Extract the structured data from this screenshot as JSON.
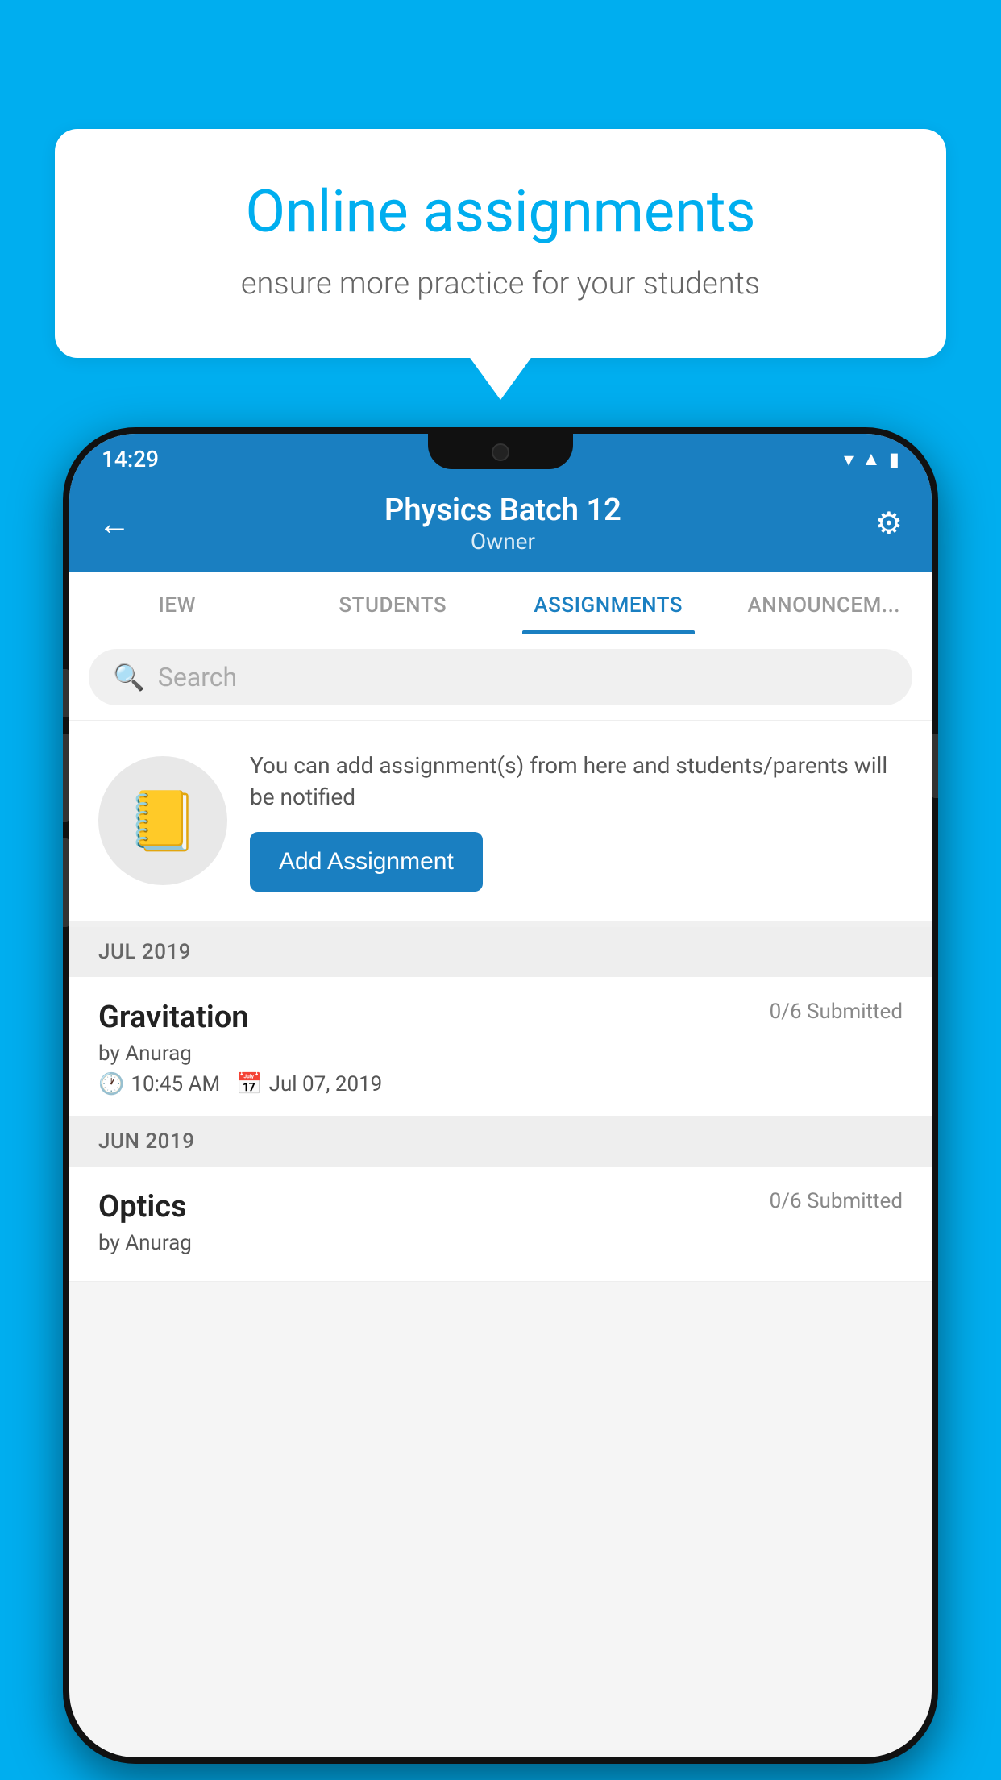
{
  "background_color": "#00AEEF",
  "speech_bubble": {
    "title": "Online assignments",
    "subtitle": "ensure more practice for your students"
  },
  "status_bar": {
    "time": "14:29",
    "wifi": "▼",
    "signal": "▲",
    "battery": "▐"
  },
  "header": {
    "title": "Physics Batch 12",
    "subtitle": "Owner",
    "back_label": "←",
    "settings_label": "⚙"
  },
  "tabs": [
    {
      "label": "IEW",
      "active": false
    },
    {
      "label": "STUDENTS",
      "active": false
    },
    {
      "label": "ASSIGNMENTS",
      "active": true
    },
    {
      "label": "ANNOUNCEMENTS",
      "active": false
    }
  ],
  "search": {
    "placeholder": "Search"
  },
  "promo": {
    "description": "You can add assignment(s) from here and students/parents will be notified",
    "button_label": "Add Assignment"
  },
  "sections": [
    {
      "label": "JUL 2019",
      "assignments": [
        {
          "name": "Gravitation",
          "submitted": "0/6 Submitted",
          "by": "by Anurag",
          "time": "10:45 AM",
          "date": "Jul 07, 2019"
        }
      ]
    },
    {
      "label": "JUN 2019",
      "assignments": [
        {
          "name": "Optics",
          "submitted": "0/6 Submitted",
          "by": "by Anurag",
          "time": "",
          "date": ""
        }
      ]
    }
  ]
}
